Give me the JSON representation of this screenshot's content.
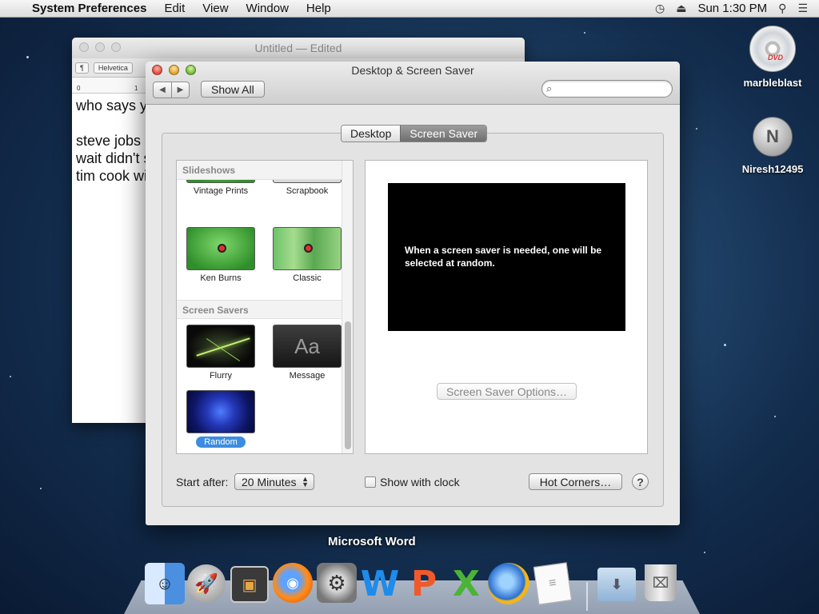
{
  "menubar": {
    "app_name": "System Preferences",
    "items": [
      "Edit",
      "View",
      "Window",
      "Help"
    ],
    "clock": "Sun 1:30 PM"
  },
  "desktop_icons": [
    {
      "label": "marbleblast",
      "icon": "dvd-icon",
      "badge": "DVD"
    },
    {
      "label": "Niresh12495",
      "icon": "disk-image-icon",
      "badge": "N"
    }
  ],
  "textedit": {
    "title": "Untitled",
    "edited": "— Edited",
    "style_control": "¶",
    "font_control": "Helvetica",
    "ruler_marks": [
      "0",
      "1"
    ],
    "lines": [
      "who says y",
      "",
      "steve jobs",
      "wait didn't s",
      "tim cook wi"
    ]
  },
  "prefs": {
    "title": "Desktop & Screen Saver",
    "show_all": "Show All",
    "search_placeholder": "",
    "tabs": [
      {
        "label": "Desktop",
        "selected": false
      },
      {
        "label": "Screen Saver",
        "selected": true
      }
    ],
    "sections": {
      "slideshows": {
        "header": "Slideshows",
        "items": [
          "Vintage Prints",
          "Scrapbook",
          "Ken Burns",
          "Classic"
        ]
      },
      "screensavers": {
        "header": "Screen Savers",
        "items": [
          "Flurry",
          "Message",
          "Random"
        ],
        "message_thumb_text": "Aa",
        "selected": "Random"
      }
    },
    "preview_text": "When a screen saver is needed, one will be selected at random.",
    "options_button": "Screen Saver Options…",
    "start_after_label": "Start after:",
    "start_after_value": "20 Minutes",
    "show_clock_label": "Show with clock",
    "show_clock_checked": false,
    "hot_corners": "Hot Corners…",
    "help": "?"
  },
  "dock": {
    "hover_label": "Microsoft Word",
    "items": [
      "Finder",
      "Launchpad",
      "Photo Booth",
      "Firefox",
      "System Preferences",
      "Microsoft Word",
      "Microsoft PowerPoint",
      "Microsoft Excel",
      "Weather",
      "TextEdit",
      "Downloads",
      "Trash"
    ]
  },
  "colors": {
    "selection": "#3b8de0",
    "tab_selected": "#7f7f7f"
  }
}
